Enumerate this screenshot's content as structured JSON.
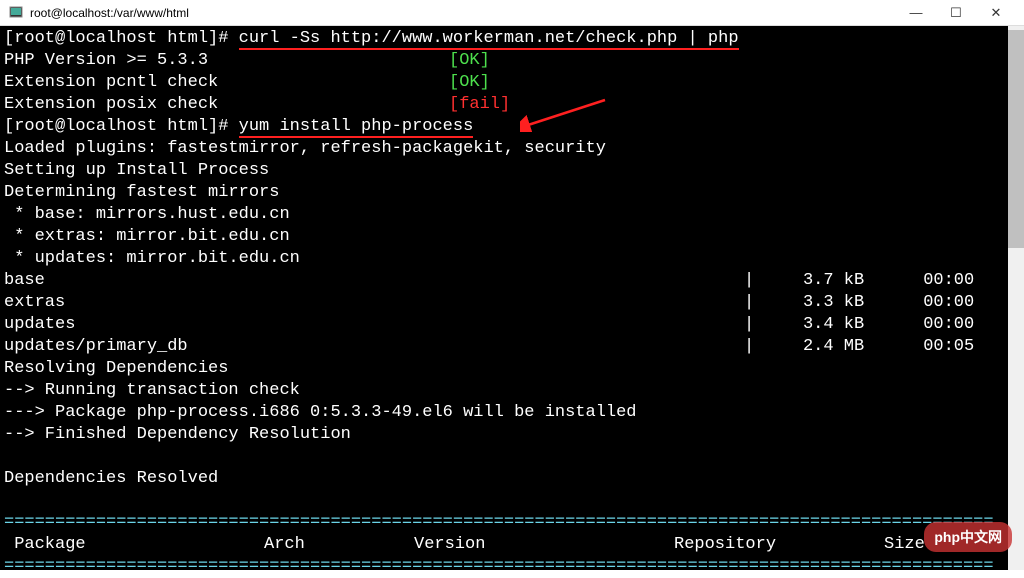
{
  "window": {
    "title": "root@localhost:/var/www/html"
  },
  "terminal": {
    "prompt1": "[root@localhost html]# ",
    "cmd1": "curl -Ss http://www.workerman.net/check.php | php",
    "check1_label": "PHP Version >= 5.3.3",
    "check1_status": "[OK]",
    "check2_label": "Extension pcntl check",
    "check2_status": "[OK]",
    "check3_label": "Extension posix check",
    "check3_status": "[fail]",
    "prompt2": "[root@localhost html]# ",
    "cmd2": "yum install php-process",
    "plugins": "Loaded plugins: fastestmirror, refresh-packagekit, security",
    "setup": "Setting up Install Process",
    "determining": "Determining fastest mirrors",
    "mirror_base": " * base: mirrors.hust.edu.cn",
    "mirror_extras": " * extras: mirror.bit.edu.cn",
    "mirror_updates": " * updates: mirror.bit.edu.cn",
    "repos": [
      {
        "name": "base",
        "size": "3.7 kB",
        "time": "00:00"
      },
      {
        "name": "extras",
        "size": "3.3 kB",
        "time": "00:00"
      },
      {
        "name": "updates",
        "size": "3.4 kB",
        "time": "00:00"
      },
      {
        "name": "updates/primary_db",
        "size": "2.4 MB",
        "time": "00:05"
      }
    ],
    "resolving": "Resolving Dependencies",
    "running_check": "--> Running transaction check",
    "pkg_install": "---> Package php-process.i686 0:5.3.3-49.el6 will be installed",
    "finished": "--> Finished Dependency Resolution",
    "deps_resolved": "Dependencies Resolved",
    "table_header": {
      "c1": " Package",
      "c2": "Arch",
      "c3": "Version",
      "c4": "Repository",
      "c5": "Size"
    }
  },
  "watermark": "php中文网"
}
